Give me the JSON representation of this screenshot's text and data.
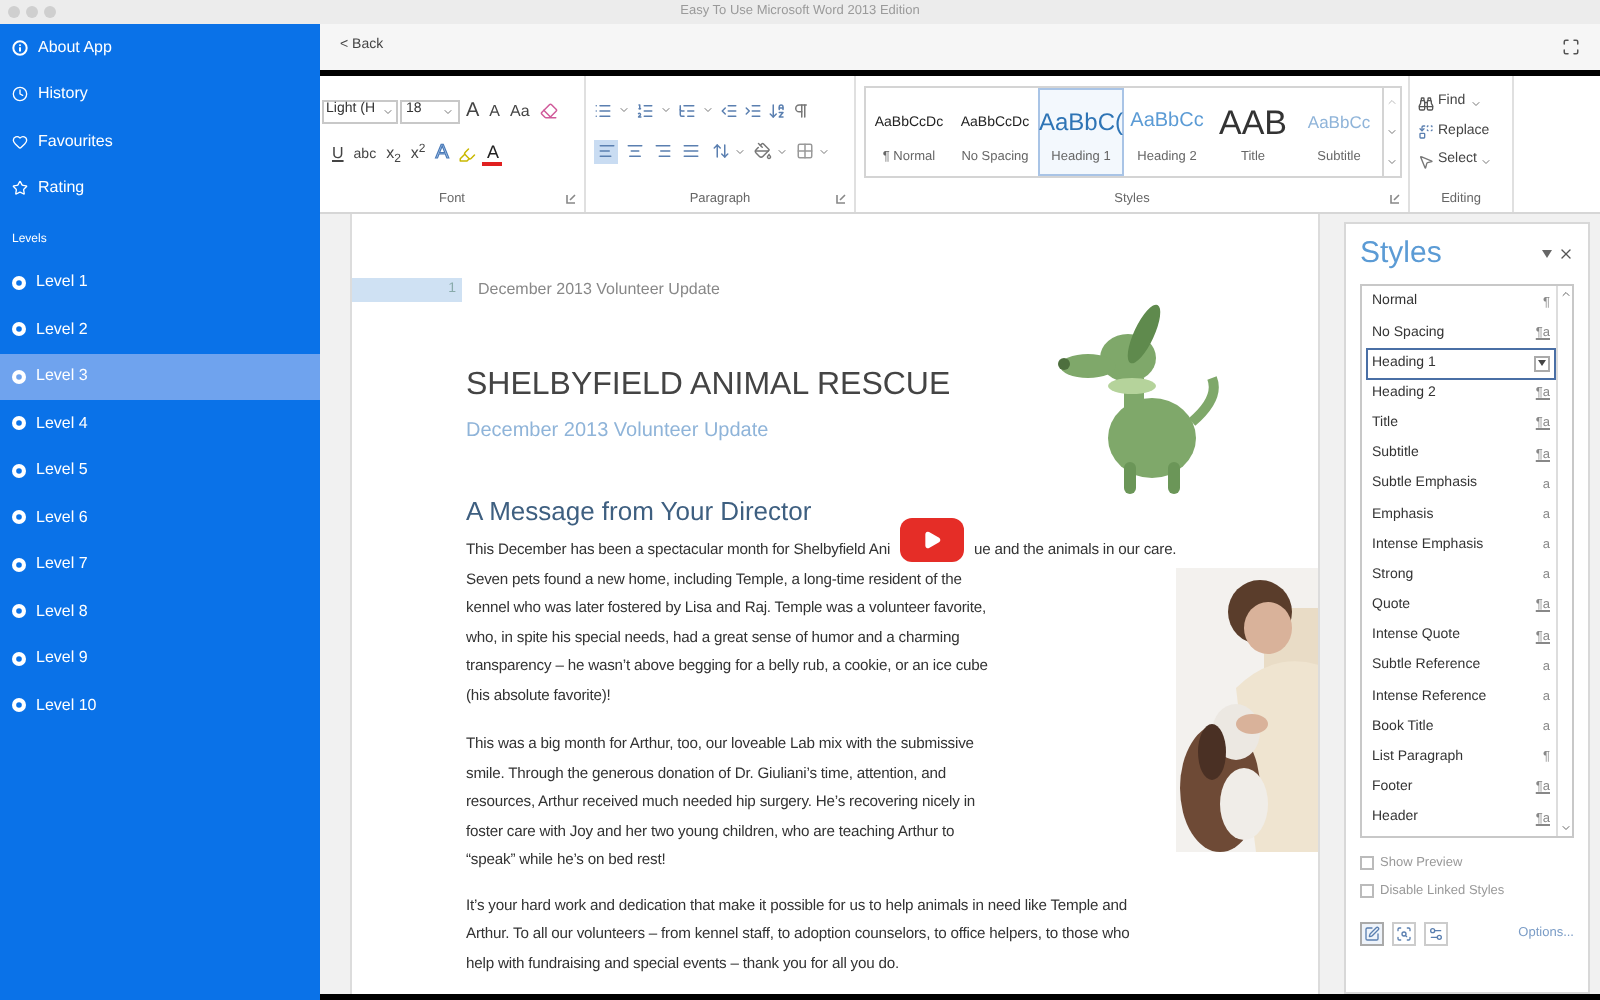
{
  "window": {
    "title": "Easy To Use Microsoft Word 2013 Edition"
  },
  "sidebar": {
    "items": [
      {
        "label": "About App",
        "kind": "info"
      },
      {
        "label": "History",
        "kind": "history"
      },
      {
        "label": "Favourites",
        "kind": "heart"
      },
      {
        "label": "Rating",
        "kind": "star"
      }
    ],
    "section_title": "Levels",
    "levels": [
      {
        "label": "Level 1",
        "selected": false
      },
      {
        "label": "Level 2",
        "selected": false
      },
      {
        "label": "Level 3",
        "selected": true
      },
      {
        "label": "Level 4",
        "selected": false
      },
      {
        "label": "Level 5",
        "selected": false
      },
      {
        "label": "Level 6",
        "selected": false
      },
      {
        "label": "Level 7",
        "selected": false
      },
      {
        "label": "Level 8",
        "selected": false
      },
      {
        "label": "Level 9",
        "selected": false
      },
      {
        "label": "Level 10",
        "selected": false
      }
    ]
  },
  "toolbar": {
    "back": "< Back"
  },
  "ribbon": {
    "font": {
      "label": "Font",
      "font_name": "Light (H",
      "font_size": "18",
      "row1": [
        {
          "kind": "grow",
          "label": "A"
        },
        {
          "kind": "shrink",
          "label": "A"
        },
        {
          "kind": "case",
          "label": "Aa"
        },
        {
          "kind": "clear"
        }
      ],
      "row2": [
        {
          "kind": "underline",
          "label": "U"
        },
        {
          "kind": "strike",
          "label": "abc"
        },
        {
          "kind": "script",
          "label": "x$_{2}$"
        },
        {
          "kind": "script",
          "label": "x$^{2}$"
        },
        {
          "kind": "effects",
          "label": "A"
        },
        {
          "kind": "highlight"
        },
        {
          "kind": "color",
          "label": "A"
        }
      ]
    },
    "paragraph": {
      "label": "Paragraph",
      "alignments": [
        {
          "kind": "left",
          "selected": true
        },
        {
          "kind": "center",
          "selected": false
        },
        {
          "kind": "right",
          "selected": false
        },
        {
          "kind": "justify",
          "selected": false
        }
      ]
    },
    "styles": {
      "label": "Styles",
      "gallery": [
        {
          "preview": "AaBbCcDc",
          "name": "¶ Normal",
          "kind": "normal",
          "selected": false
        },
        {
          "preview": "AaBbCcDc",
          "name": "No Spacing",
          "kind": "normal",
          "selected": false
        },
        {
          "preview": "AaBbC(",
          "name": "Heading 1",
          "kind": "heading1",
          "selected": true
        },
        {
          "preview": "AaBbCc",
          "name": "Heading 2",
          "kind": "heading2",
          "selected": false
        },
        {
          "preview": "AAB",
          "name": "Title",
          "kind": "title",
          "selected": false
        },
        {
          "preview": "AaBbCc",
          "name": "Subtitle",
          "kind": "subtitle",
          "selected": false
        }
      ]
    },
    "editing": {
      "label": "Editing",
      "items": [
        {
          "label": "Find",
          "kind": "find"
        },
        {
          "label": "Replace",
          "kind": "replace"
        },
        {
          "label": "Select",
          "kind": "select"
        }
      ]
    }
  },
  "document": {
    "page_number": "1",
    "header": "December 2013 Volunteer Update",
    "title": "SHELBYFIELD ANIMAL RESCUE",
    "subtitle": "December 2013 Volunteer Update",
    "heading": "A Message from Your Director",
    "paragraphs": [
      {
        "lines": [
          [
            "This December has been a spectacular month for Shelbyfield Ani",
            "ue and the animals in our care."
          ],
          [
            "Seven pets found a new home, including Temple, a long-time resident of the"
          ],
          [
            "kennel who was later fostered by Lisa and Raj. Temple was a volunteer favorite,"
          ],
          [
            "who, in spite his special needs, had a great sense of humor and a charming"
          ],
          [
            "transparency – he wasn’t above begging for a belly rub, a cookie, or an ice cube"
          ],
          [
            "(his absolute favorite)!"
          ]
        ]
      },
      {
        "lines": [
          [
            "This was a big month for Arthur, too, our loveable Lab mix with the submissive"
          ],
          [
            "smile. Through the generous donation of Dr. Giuliani’s time, attention, and"
          ],
          [
            "resources, Arthur received much needed hip surgery. He’s recovering nicely in"
          ],
          [
            "foster care with Joy and her two young children, who are teaching Arthur to"
          ],
          [
            "“speak” while he’s on bed rest!"
          ]
        ]
      },
      {
        "lines": [
          [
            "It’s your hard work and dedication that make it possible for us to help animals in need like Temple and"
          ],
          [
            "Arthur. To all our volunteers – from kennel staff, to adoption counselors, to office helpers, to those who"
          ],
          [
            "help with fundraising and special events – thank you for all you do."
          ]
        ]
      }
    ]
  },
  "styles_pane": {
    "title": "Styles",
    "items": [
      {
        "name": "Normal",
        "marker": "¶",
        "kind": "paragraph",
        "selected": false
      },
      {
        "name": "No Spacing",
        "marker": "¶a",
        "kind": "linked",
        "selected": false
      },
      {
        "name": "Heading 1",
        "selected": true
      },
      {
        "name": "Heading 2",
        "marker": "¶a",
        "kind": "linked",
        "selected": false
      },
      {
        "name": "Title",
        "marker": "¶a",
        "kind": "linked",
        "selected": false
      },
      {
        "name": "Subtitle",
        "marker": "¶a",
        "kind": "linked",
        "selected": false
      },
      {
        "name": "Subtle Emphasis",
        "marker": "a",
        "kind": "character",
        "selected": false
      },
      {
        "name": "Emphasis",
        "marker": "a",
        "kind": "character",
        "selected": false
      },
      {
        "name": "Intense Emphasis",
        "marker": "a",
        "kind": "character",
        "selected": false
      },
      {
        "name": "Strong",
        "marker": "a",
        "kind": "character",
        "selected": false
      },
      {
        "name": "Quote",
        "marker": "¶a",
        "kind": "linked",
        "selected": false
      },
      {
        "name": "Intense Quote",
        "marker": "¶a",
        "kind": "linked",
        "selected": false
      },
      {
        "name": "Subtle Reference",
        "marker": "a",
        "kind": "character",
        "selected": false
      },
      {
        "name": "Intense Reference",
        "marker": "a",
        "kind": "character",
        "selected": false
      },
      {
        "name": "Book Title",
        "marker": "a",
        "kind": "character",
        "selected": false
      },
      {
        "name": "List Paragraph",
        "marker": "¶",
        "kind": "paragraph",
        "selected": false
      },
      {
        "name": "Footer",
        "marker": "¶a",
        "kind": "linked",
        "selected": false
      },
      {
        "name": "Header",
        "marker": "¶a",
        "kind": "linked",
        "selected": false
      }
    ],
    "checkboxes": [
      {
        "label": "Show Preview",
        "checked": false
      },
      {
        "label": "Disable Linked Styles",
        "checked": false
      }
    ],
    "options": "Options..."
  }
}
